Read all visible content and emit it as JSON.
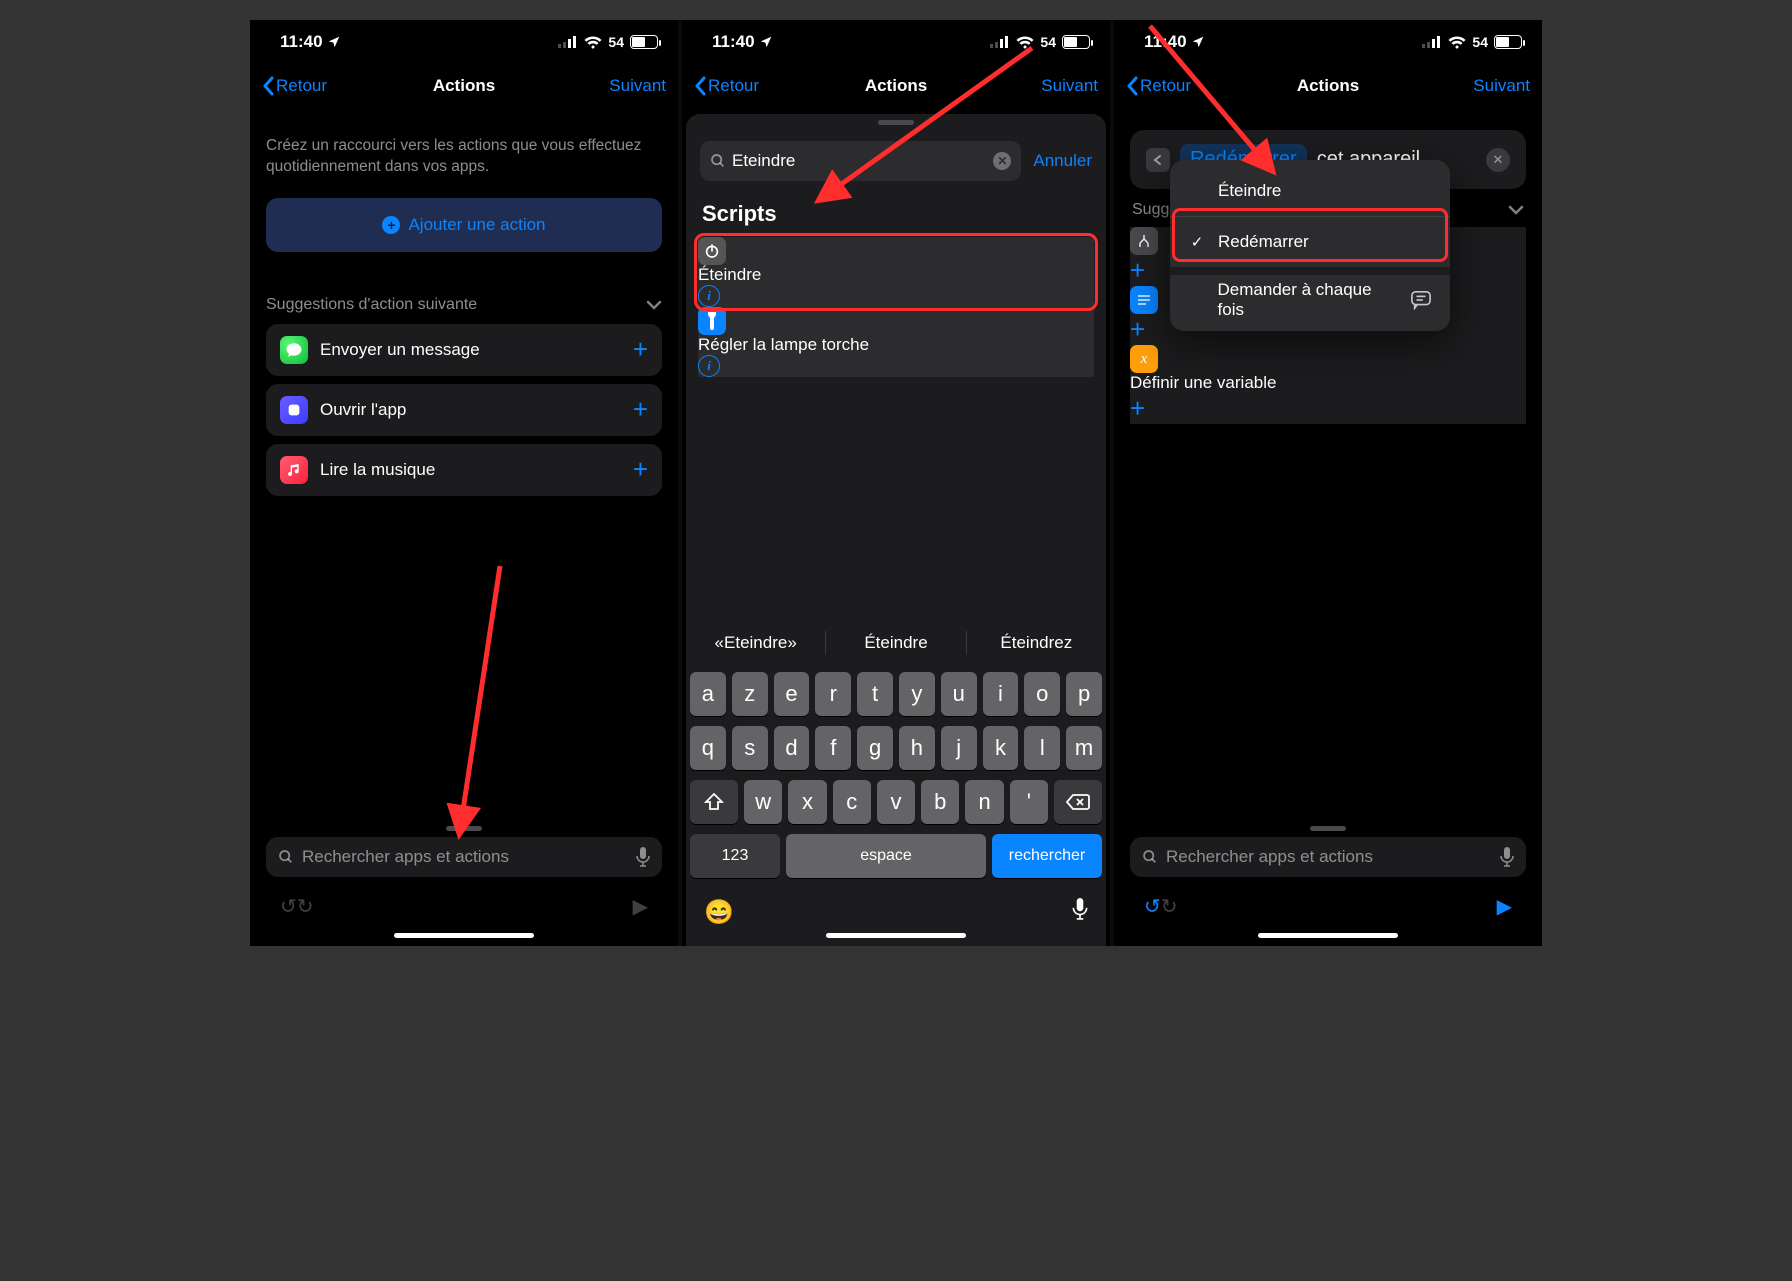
{
  "status": {
    "time": "11:40",
    "battery": "54"
  },
  "nav": {
    "back": "Retour",
    "title": "Actions",
    "next": "Suivant"
  },
  "screen1": {
    "intro": "Créez un raccourci vers les actions que vous effectuez quotidiennement dans vos apps.",
    "add_action": "Ajouter une action",
    "suggestions_header": "Suggestions d'action suivante",
    "suggestions": [
      {
        "label": "Envoyer un message"
      },
      {
        "label": "Ouvrir l'app"
      },
      {
        "label": "Lire la musique"
      }
    ],
    "search_placeholder": "Rechercher apps et actions"
  },
  "screen2": {
    "search_value": "Eteindre",
    "cancel": "Annuler",
    "section": "Scripts",
    "results": [
      {
        "label": "Éteindre"
      },
      {
        "label": "Régler la lampe torche"
      }
    ],
    "predictions": [
      "«Eteindre»",
      "Éteindre",
      "Éteindrez"
    ],
    "kb_row1": [
      "a",
      "z",
      "e",
      "r",
      "t",
      "y",
      "u",
      "i",
      "o",
      "p"
    ],
    "kb_row2": [
      "q",
      "s",
      "d",
      "f",
      "g",
      "h",
      "j",
      "k",
      "l",
      "m"
    ],
    "kb_row3": [
      "w",
      "x",
      "c",
      "v",
      "b",
      "n",
      "'"
    ],
    "kb_123": "123",
    "kb_space": "espace",
    "kb_search": "rechercher"
  },
  "screen3": {
    "param": "Redémarrer",
    "param_suffix": "cet appareil",
    "dropdown": {
      "opt1": "Éteindre",
      "opt2": "Redémarrer",
      "opt3": "Demander à chaque fois"
    },
    "sugg_header": "Suggestions d'action suivante",
    "partial_sugg": "Sugg",
    "rows": [
      {
        "label": ""
      },
      {
        "label": ""
      },
      {
        "label": "Définir une variable"
      }
    ],
    "search_placeholder": "Rechercher apps et actions"
  }
}
